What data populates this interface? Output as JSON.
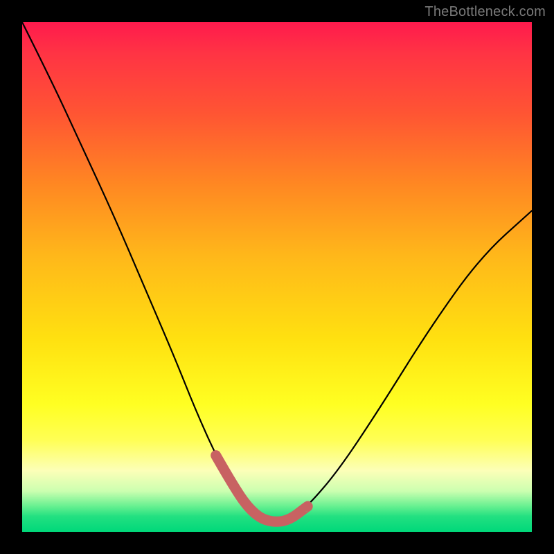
{
  "watermark": "TheBottleneck.com",
  "colors": {
    "frame_bg": "#000000",
    "curve": "#000000",
    "highlight": "#c86262",
    "gradient_top": "#ff1a4d",
    "gradient_bottom": "#00d87a"
  },
  "chart_data": {
    "type": "line",
    "title": "",
    "xlabel": "",
    "ylabel": "",
    "xlim": [
      0,
      100
    ],
    "ylim": [
      0,
      100
    ],
    "annotations": [],
    "series": [
      {
        "name": "v-curve",
        "x": [
          0,
          6,
          12,
          18,
          24,
          30,
          34,
          38,
          42,
          45,
          48,
          52,
          56,
          62,
          70,
          80,
          90,
          100
        ],
        "values": [
          100,
          88,
          75,
          62,
          48,
          34,
          24,
          15,
          8,
          4,
          2,
          2,
          5,
          12,
          24,
          40,
          54,
          63
        ]
      }
    ],
    "highlight_segment": {
      "description": "thick muted-red overlay at trough of v-curve",
      "x": [
        38,
        42,
        45,
        48,
        52,
        56
      ],
      "values": [
        15,
        8,
        4,
        2,
        2,
        5
      ]
    }
  }
}
